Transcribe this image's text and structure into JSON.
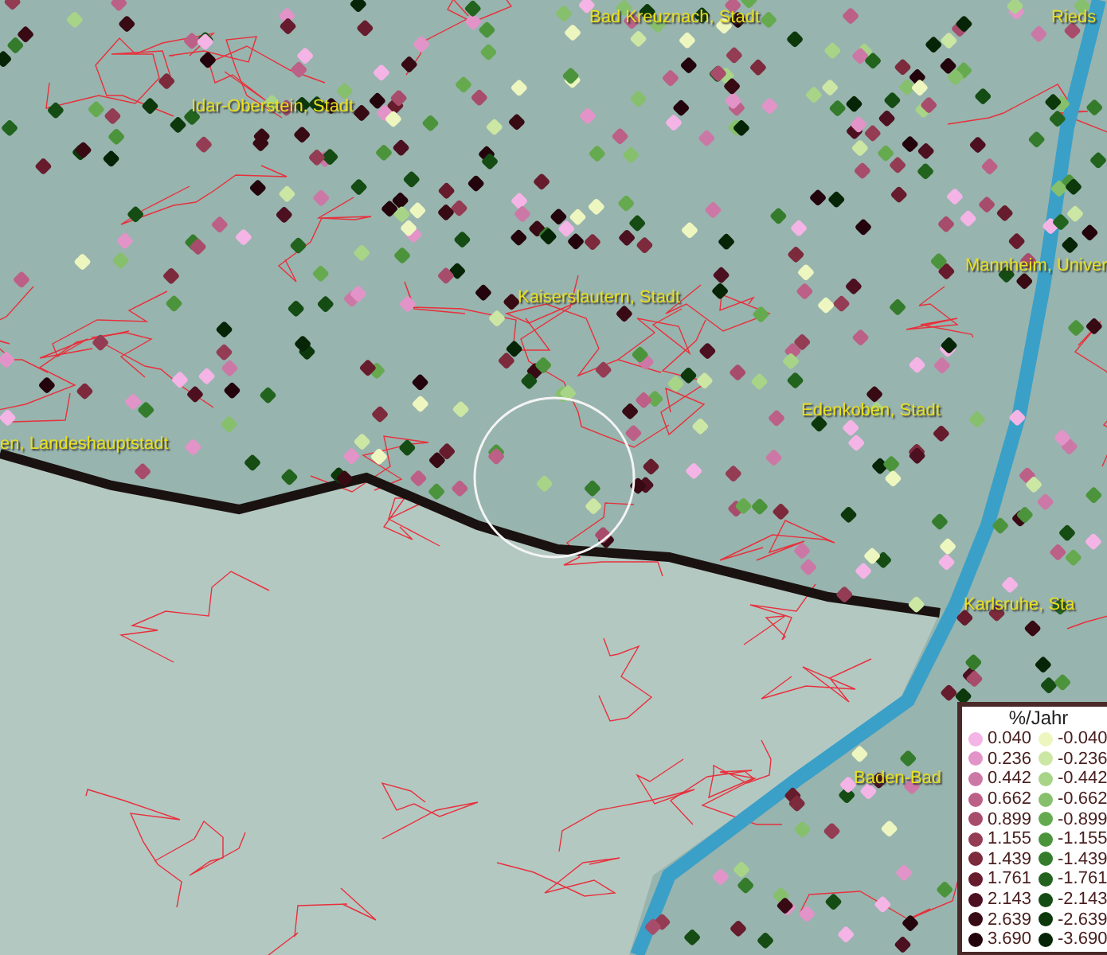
{
  "map": {
    "place_labels": [
      {
        "text": "Bad Kreuznach, Stadt"
      },
      {
        "text": "Rieds"
      },
      {
        "text": "Idar-Oberstein, Stadt"
      },
      {
        "text": "Mannheim, Univer"
      },
      {
        "text": "Kaiserslautern, Stadt"
      },
      {
        "text": "Edenkoben, Stadt"
      },
      {
        "text": "en, Landeshauptstadt"
      },
      {
        "text": "Karlsruhe, Sta"
      },
      {
        "text": "Baden-Bad"
      }
    ]
  },
  "legend": {
    "title": "%/Jahr",
    "rows": [
      {
        "positive": {
          "label": "0.040",
          "color": "#f4b4e6"
        },
        "negative": {
          "label": "-0.040",
          "color": "#eef6c0"
        }
      },
      {
        "positive": {
          "label": "0.236",
          "color": "#e294c8"
        },
        "negative": {
          "label": "-0.236",
          "color": "#cce6a4"
        }
      },
      {
        "positive": {
          "label": "0.442",
          "color": "#cc78a6"
        },
        "negative": {
          "label": "-0.442",
          "color": "#a8d488"
        }
      },
      {
        "positive": {
          "label": "0.662",
          "color": "#bc6088"
        },
        "negative": {
          "label": "-0.662",
          "color": "#86c06c"
        }
      },
      {
        "positive": {
          "label": "0.899",
          "color": "#a84c6c"
        },
        "negative": {
          "label": "-0.899",
          "color": "#66aa50"
        }
      },
      {
        "positive": {
          "label": "1.155",
          "color": "#943c54"
        },
        "negative": {
          "label": "-1.155",
          "color": "#4c943c"
        }
      },
      {
        "positive": {
          "label": "1.439",
          "color": "#7c2a3c"
        },
        "negative": {
          "label": "-1.439",
          "color": "#347c2c"
        }
      },
      {
        "positive": {
          "label": "1.761",
          "color": "#661c2c"
        },
        "negative": {
          "label": "-1.761",
          "color": "#22641e"
        }
      },
      {
        "positive": {
          "label": "2.143",
          "color": "#4c1020"
        },
        "negative": {
          "label": "-2.143",
          "color": "#144c14"
        }
      },
      {
        "positive": {
          "label": "2.639",
          "color": "#380a14"
        },
        "negative": {
          "label": "-2.639",
          "color": "#0c380c"
        }
      },
      {
        "positive": {
          "label": "3.690",
          "color": "#24040c"
        },
        "negative": {
          "label": "-3.690",
          "color": "#062406"
        }
      }
    ]
  }
}
